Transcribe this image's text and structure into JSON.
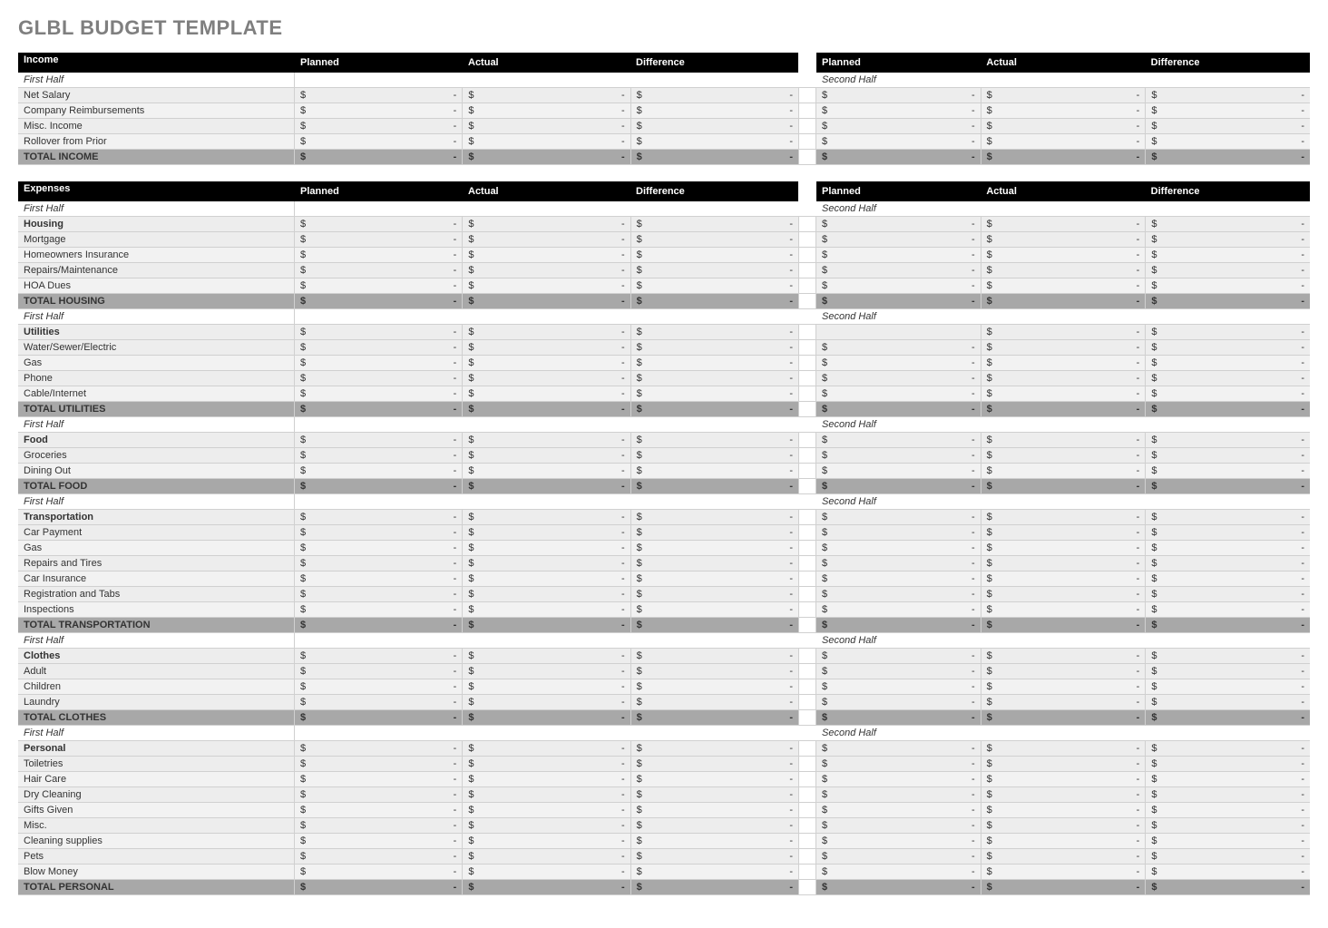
{
  "title": "GLBL BUDGET TEMPLATE",
  "halfLabels": {
    "first": "First Half",
    "second": "Second Half"
  },
  "columns": [
    "Planned",
    "Actual",
    "Difference"
  ],
  "currency": "$",
  "dash": "-",
  "sections": [
    {
      "header_label": "Income",
      "groups": [
        {
          "subhead": true,
          "rows": [
            {
              "label": "Net Salary"
            },
            {
              "label": "Company Reimbursements"
            },
            {
              "label": "Misc. Income"
            },
            {
              "label": "Rollover from Prior"
            }
          ],
          "total_label": "TOTAL INCOME"
        }
      ]
    },
    {
      "header_label": "Expenses",
      "groups": [
        {
          "subhead": true,
          "cat_label": "Housing",
          "rows": [
            {
              "label": "Mortgage"
            },
            {
              "label": "Homeowners Insurance"
            },
            {
              "label": "Repairs/Maintenance"
            },
            {
              "label": "HOA Dues"
            }
          ],
          "total_label": "TOTAL HOUSING"
        },
        {
          "subhead": true,
          "cat_label": "Utilities",
          "cat_right_blank_first": true,
          "rows": [
            {
              "label": "Water/Sewer/Electric"
            },
            {
              "label": "Gas"
            },
            {
              "label": "Phone"
            },
            {
              "label": "Cable/Internet"
            }
          ],
          "total_label": "TOTAL UTILITIES"
        },
        {
          "subhead": true,
          "cat_label": "Food",
          "rows": [
            {
              "label": "Groceries"
            },
            {
              "label": "Dining Out"
            }
          ],
          "total_label": "TOTAL FOOD"
        },
        {
          "subhead": true,
          "cat_label": "Transportation",
          "rows": [
            {
              "label": "Car Payment"
            },
            {
              "label": "Gas"
            },
            {
              "label": "Repairs and Tires"
            },
            {
              "label": "Car Insurance"
            },
            {
              "label": "Registration and Tabs"
            },
            {
              "label": "Inspections"
            }
          ],
          "total_label": "TOTAL TRANSPORTATION"
        },
        {
          "subhead": true,
          "cat_label": "Clothes",
          "rows": [
            {
              "label": "Adult"
            },
            {
              "label": "Children"
            },
            {
              "label": "Laundry"
            }
          ],
          "total_label": "TOTAL CLOTHES"
        },
        {
          "subhead": true,
          "cat_label": "Personal",
          "rows": [
            {
              "label": "Toiletries"
            },
            {
              "label": "Hair Care"
            },
            {
              "label": "Dry Cleaning"
            },
            {
              "label": "Gifts Given"
            },
            {
              "label": "Misc."
            },
            {
              "label": "Cleaning supplies"
            },
            {
              "label": "Pets"
            },
            {
              "label": "Blow Money"
            }
          ],
          "total_label": "TOTAL PERSONAL"
        }
      ]
    }
  ]
}
